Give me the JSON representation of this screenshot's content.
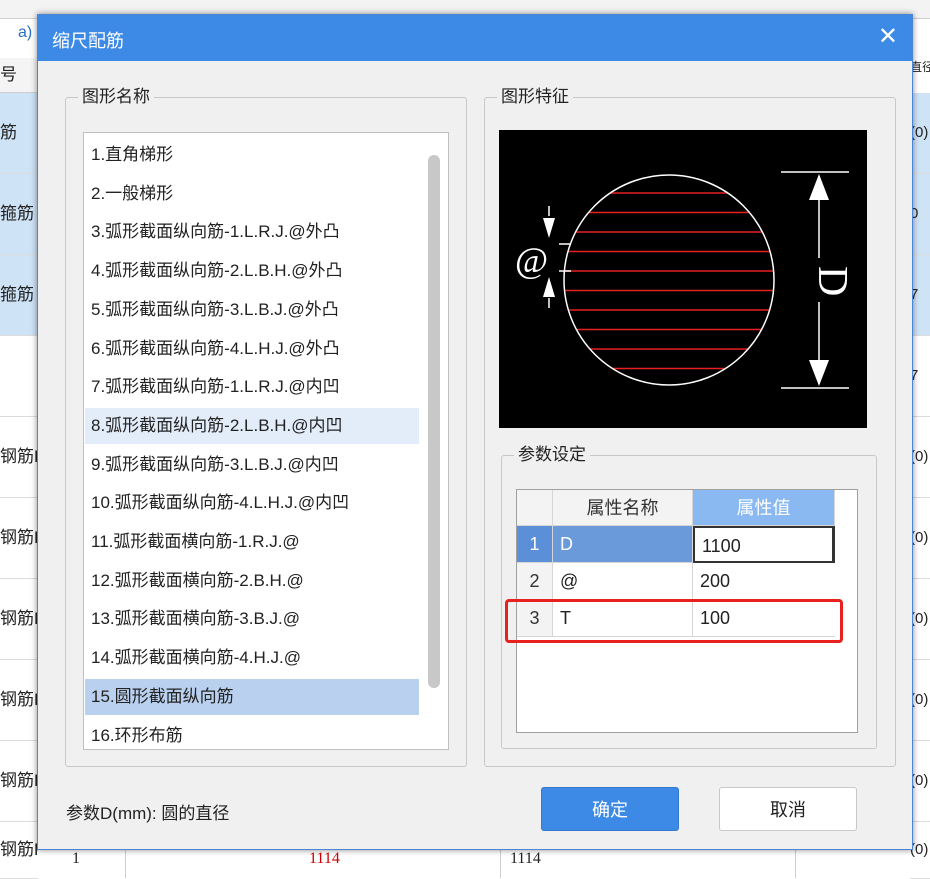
{
  "background": {
    "link_text": "a)",
    "header_left": "号",
    "left_cells": [
      "筋",
      "箍筋",
      "箍筋",
      "",
      "钢筋F",
      "钢筋F",
      "钢筋F",
      "钢筋F",
      "钢筋F",
      "钢筋F"
    ],
    "right_cells": [
      "(0)",
      "0",
      "7",
      "7",
      "(0)",
      "(0)",
      "(0)",
      "(0)",
      "(0)",
      "(0)"
    ],
    "right_header": "直径",
    "bottom_row": {
      "index": "1",
      "red_value": "1114",
      "value": "1114",
      "right": "(0)"
    }
  },
  "dialog": {
    "title": "缩尺配筋",
    "close_glyph": "✕",
    "shape_name_group": "图形名称",
    "shape_feature_group": "图形特征",
    "param_group": "参数设定",
    "items": [
      "1.直角梯形",
      "2.一般梯形",
      "3.弧形截面纵向筋-1.L.R.J.@外凸",
      "4.弧形截面纵向筋-2.L.B.H.@外凸",
      "5.弧形截面纵向筋-3.L.B.J.@外凸",
      "6.弧形截面纵向筋-4.L.H.J.@外凸",
      "7.弧形截面纵向筋-1.L.R.J.@内凹",
      "8.弧形截面纵向筋-2.L.B.H.@内凹",
      "9.弧形截面纵向筋-3.L.B.J.@内凹",
      "10.弧形截面纵向筋-4.L.H.J.@内凹",
      "11.弧形截面横向筋-1.R.J.@",
      "12.弧形截面横向筋-2.B.H.@",
      "13.弧形截面横向筋-3.B.J.@",
      "14.弧形截面横向筋-4.H.J.@",
      "15.圆形截面纵向筋",
      "16.环形布筋"
    ],
    "hover_index": 7,
    "selected_index": 14,
    "figure": {
      "label_at": "@",
      "label_d": "D",
      "rebar_color": "#e8201e",
      "outline_color": "#ffffff"
    },
    "grid": {
      "col_name": "属性名称",
      "col_value": "属性值",
      "rows": [
        {
          "num": "1",
          "name": "D",
          "value": "1100"
        },
        {
          "num": "2",
          "name": "@",
          "value": "200"
        },
        {
          "num": "3",
          "name": "T",
          "value": "100"
        }
      ]
    },
    "description": "参数D(mm): 圆的直径",
    "ok_label": "确定",
    "cancel_label": "取消",
    "colors": {
      "title_bar": "#3c8ae6",
      "highlight": "#e8201e",
      "selection": "#b9d1ef"
    }
  }
}
